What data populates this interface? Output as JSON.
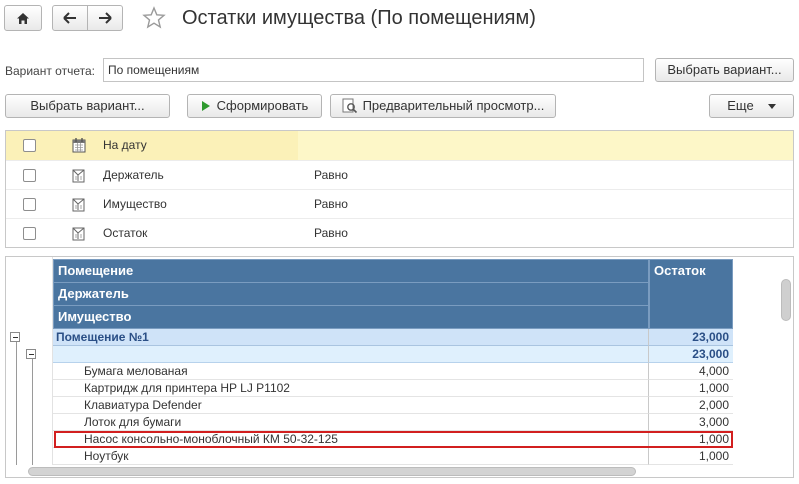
{
  "window": {
    "title": "Остатки имущества (По помещениям)"
  },
  "variant": {
    "label": "Вариант отчета:",
    "value": "По помещениям",
    "choose_button": "Выбрать вариант..."
  },
  "toolbar": {
    "choose_variant": "Выбрать вариант...",
    "generate": "Сформировать",
    "preview": "Предварительный просмотр...",
    "more": "Еще"
  },
  "filters": [
    {
      "name": "На дату",
      "condition": ""
    },
    {
      "name": "Держатель",
      "condition": "Равно"
    },
    {
      "name": "Имущество",
      "condition": "Равно"
    },
    {
      "name": "Остаток",
      "condition": "Равно"
    }
  ],
  "report": {
    "headers": {
      "room": "Помещение",
      "holder": "Держатель",
      "property": "Имущество",
      "balance": "Остаток"
    },
    "rows": [
      {
        "name": "Помещение №1",
        "value": "23,000",
        "level": 1
      },
      {
        "name": "",
        "value": "23,000",
        "level": 2
      },
      {
        "name": "Бумага мелованая",
        "value": "4,000",
        "level": 3
      },
      {
        "name": "Картридж для принтера HP LJ P1102",
        "value": "1,000",
        "level": 3
      },
      {
        "name": "Клавиатура Defender",
        "value": "2,000",
        "level": 3
      },
      {
        "name": "Лоток для бумаги",
        "value": "3,000",
        "level": 3
      },
      {
        "name": "Насос консольно-моноблочный КМ 50-32-125",
        "value": "1,000",
        "level": 3
      },
      {
        "name": "Ноутбук",
        "value": "1,000",
        "level": 3
      }
    ]
  },
  "colors": {
    "header_bg": "#4a75a0",
    "group_bg": "#cfe3f8",
    "selected_filter": "#fbf1b8",
    "highlight_border": "#d21f1f"
  }
}
